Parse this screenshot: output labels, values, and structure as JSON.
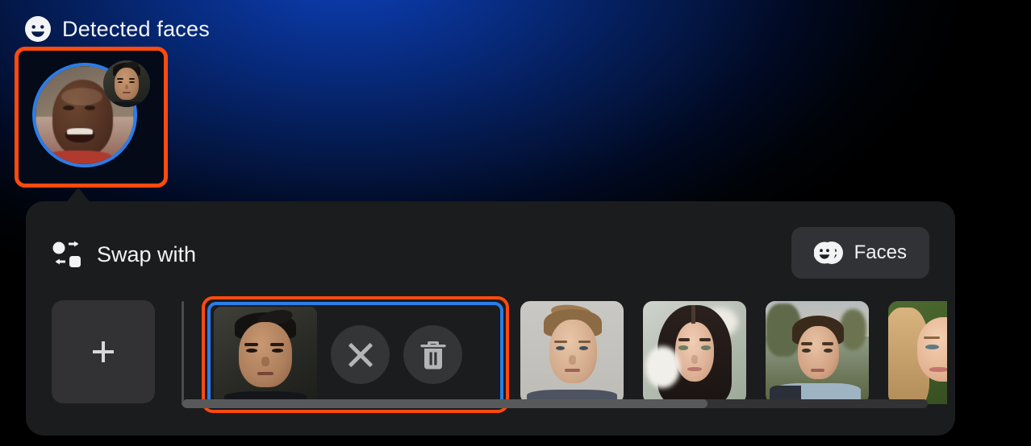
{
  "theme": {
    "accent_orange": "#ff4a0f",
    "selection_blue": "#2b7de9",
    "panel_bg": "#1b1c1e",
    "button_bg": "#313235",
    "background_blue": "#0b3fb4"
  },
  "detected_section": {
    "icon": "smiley-face-icon",
    "title": "Detected faces",
    "faces": [
      {
        "name": "detected-face-1",
        "selected": true,
        "has_swap_badge": true,
        "badge_icon": "swap-target-face-badge"
      }
    ]
  },
  "swap_panel": {
    "header": {
      "icon": "swap-arrows-icon",
      "title": "Swap with"
    },
    "faces_button": {
      "icon": "two-faces-icon",
      "label": "Faces"
    },
    "add_button": {
      "icon": "plus-icon",
      "label": "+"
    },
    "items": [
      {
        "name": "swap-face-selected",
        "selected": true,
        "actions": [
          {
            "name": "deselect-button",
            "icon": "close-x-icon"
          },
          {
            "name": "delete-button",
            "icon": "trash-icon"
          }
        ]
      },
      {
        "name": "swap-face-2",
        "selected": false
      },
      {
        "name": "swap-face-3",
        "selected": false
      },
      {
        "name": "swap-face-4",
        "selected": false
      },
      {
        "name": "swap-face-5",
        "selected": false
      }
    ],
    "scrollbar": {
      "name": "horizontal-scrollbar",
      "orientation": "horizontal",
      "thumb_fraction": 0.705
    }
  }
}
